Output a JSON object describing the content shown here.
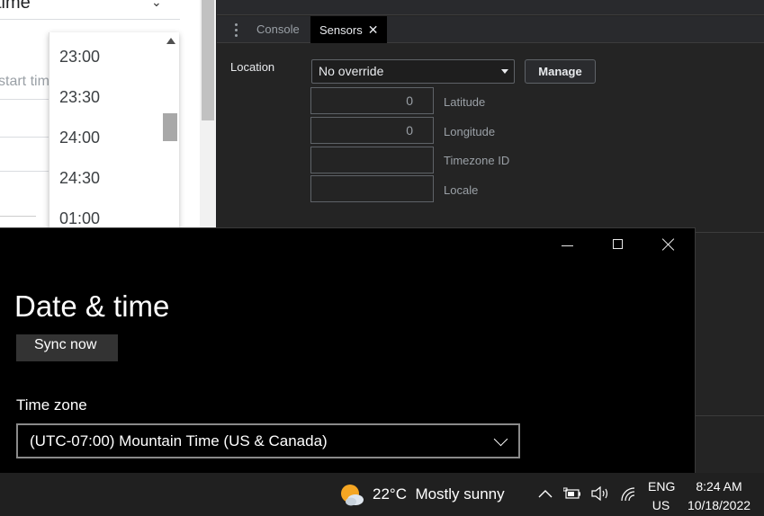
{
  "web_page": {
    "title_fragment": "time",
    "start_time_placeholder": "start tim",
    "time_options": [
      "23:00",
      "23:30",
      "24:00",
      "24:30",
      "01:00"
    ]
  },
  "devtools": {
    "tabs": [
      {
        "label": "Console",
        "active": false
      },
      {
        "label": "Sensors",
        "active": true
      }
    ],
    "close_glyph": "✕",
    "location_label": "Location",
    "location_select_value": "No override",
    "manage_label": "Manage",
    "fields": [
      {
        "label": "Latitude",
        "value": "0"
      },
      {
        "label": "Longitude",
        "value": "0"
      },
      {
        "label": "Timezone ID",
        "value": ""
      },
      {
        "label": "Locale",
        "value": ""
      }
    ]
  },
  "settings": {
    "title": "Date & time",
    "sync_button": "Sync now",
    "timezone_label": "Time zone",
    "timezone_value": "(UTC-07:00) Mountain Time (US & Canada)"
  },
  "taskbar": {
    "weather_temp": "22°C",
    "weather_desc": "Mostly sunny",
    "lang_line1": "ENG",
    "lang_line2": "US",
    "time": "8:24 AM",
    "date": "10/18/2022"
  },
  "colors": {
    "devtools_bg": "#242424",
    "settings_bg": "#000000",
    "taskbar_bg": "#202020",
    "weather_sun": "#f5a623"
  }
}
